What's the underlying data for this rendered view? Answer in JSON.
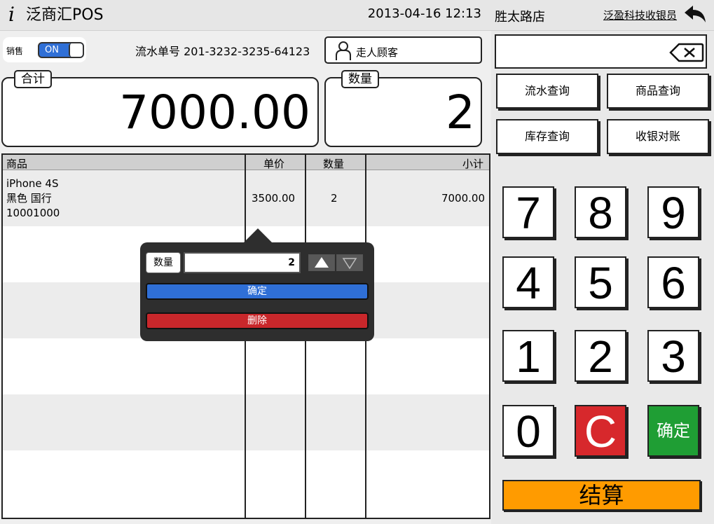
{
  "header": {
    "logo_glyph": "i",
    "app_title": "泛商汇POS",
    "datetime": "2013-04-16 12:13"
  },
  "mode": {
    "label": "销售",
    "toggle_text": "ON"
  },
  "transaction": {
    "serial_text": "流水单号 201-3232-3235-64123",
    "customer_label": "走人顾客"
  },
  "totals": {
    "total_label": "合计",
    "total_value": "7000.00",
    "qty_label": "数量",
    "qty_value": "2"
  },
  "table": {
    "columns": [
      "商品",
      "单价",
      "数量",
      "小计"
    ],
    "rows": [
      {
        "name_line1": "iPhone 4S",
        "name_line2": "黑色 国行",
        "name_line3": "10001000",
        "price": "3500.00",
        "qty": "2",
        "subtotal": "7000.00"
      }
    ]
  },
  "popover": {
    "qty_label": "数量",
    "qty_value": "2",
    "confirm_label": "确定",
    "delete_label": "删除"
  },
  "right_header": {
    "store_name": "胜太路店",
    "cashier_name": "泛盈科技收银员"
  },
  "search": {
    "value": ""
  },
  "query_buttons": [
    "流水查询",
    "商品查询",
    "库存查询",
    "收银对账"
  ],
  "keypad": {
    "keys": [
      "7",
      "8",
      "9",
      "4",
      "5",
      "6",
      "1",
      "2",
      "3",
      "0"
    ],
    "clear_label": "C",
    "ok_label": "确定"
  },
  "settle_label": "结算",
  "colors": {
    "toggle_on": "#2f6fd6",
    "confirm": "#2f6fd6",
    "delete": "#c9272b",
    "key_clear": "#d7282c",
    "key_ok": "#1f9e34",
    "settle": "#ff9b00"
  }
}
